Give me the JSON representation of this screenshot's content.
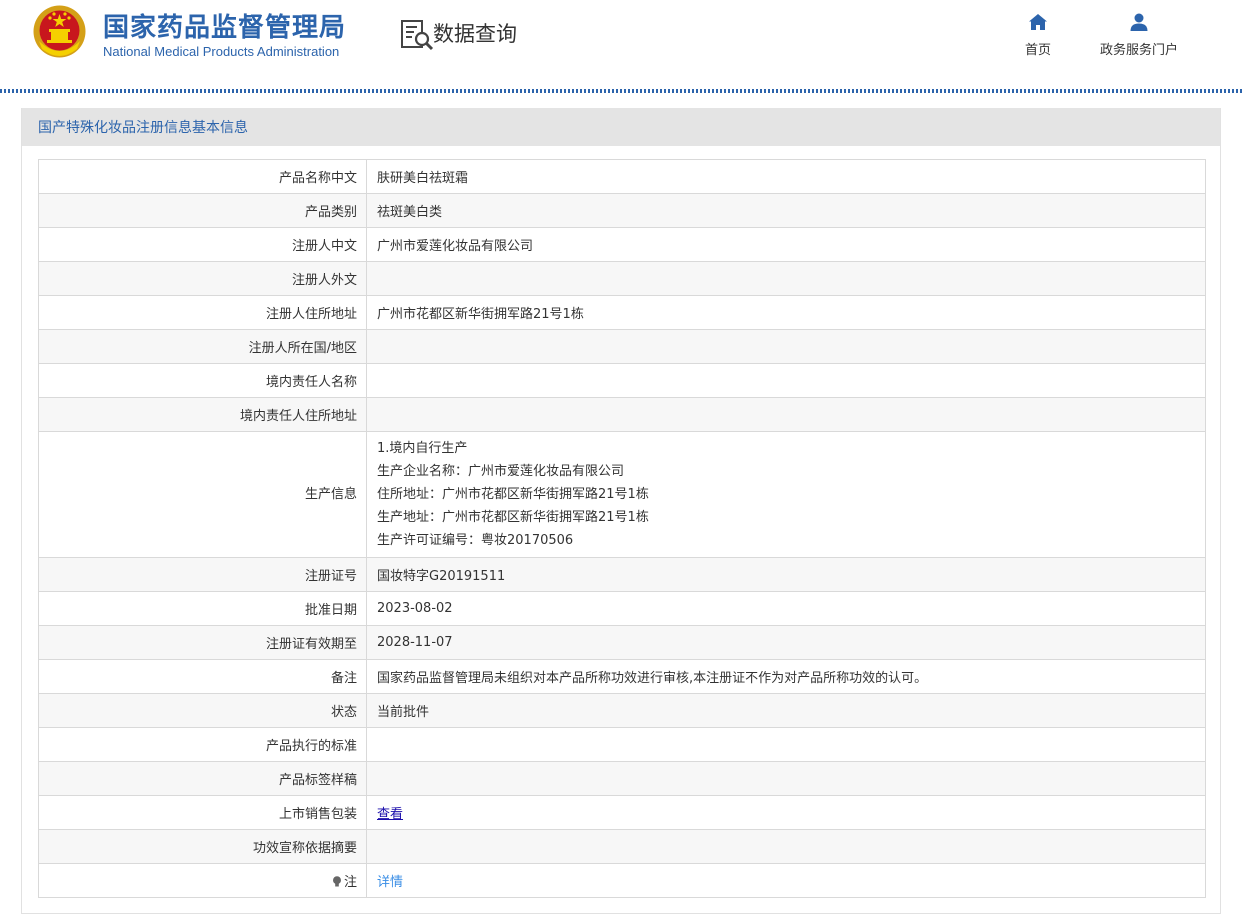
{
  "header": {
    "org_name_cn": "国家药品监督管理局",
    "org_name_en": "National Medical Products Administration",
    "section_title": "数据查询",
    "nav": [
      {
        "label": "首页",
        "icon": "home-icon"
      },
      {
        "label": "政务服务门户",
        "icon": "user-icon"
      }
    ]
  },
  "colors": {
    "brand": "#2c64ac",
    "link": "#3a8ee6",
    "visited_link": "#1a0dab"
  },
  "panel": {
    "title": "国产特殊化妆品注册信息基本信息",
    "rows": [
      {
        "label": "产品名称中文",
        "value": "肤研美白祛斑霜"
      },
      {
        "label": "产品类别",
        "value": "祛斑美白类"
      },
      {
        "label": "注册人中文",
        "value": "广州市爱莲化妆品有限公司"
      },
      {
        "label": "注册人外文",
        "value": ""
      },
      {
        "label": "注册人住所地址",
        "value": "广州市花都区新华街拥军路21号1栋"
      },
      {
        "label": "注册人所在国/地区",
        "value": ""
      },
      {
        "label": "境内责任人名称",
        "value": ""
      },
      {
        "label": "境内责任人住所地址",
        "value": ""
      }
    ],
    "production": {
      "label": "生产信息",
      "lines": [
        "1.境内自行生产",
        "生产企业名称：广州市爱莲化妆品有限公司",
        "住所地址：广州市花都区新华街拥军路21号1栋",
        "生产地址：广州市花都区新华街拥军路21号1栋",
        "生产许可证编号：粤妆20170506"
      ]
    },
    "rows2": [
      {
        "label": "注册证号",
        "value": "国妆特字G20191511"
      },
      {
        "label": "批准日期",
        "value": "2023-08-02"
      },
      {
        "label": "注册证有效期至",
        "value": "2028-11-07"
      },
      {
        "label": "备注",
        "value": "国家药品监督管理局未组织对本产品所称功效进行审核,本注册证不作为对产品所称功效的认可。"
      },
      {
        "label": "状态",
        "value": "当前批件"
      },
      {
        "label": "产品执行的标准",
        "value": ""
      },
      {
        "label": "产品标签样稿",
        "value": ""
      }
    ],
    "sales_package": {
      "label": "上市销售包装",
      "link": "查看"
    },
    "efficacy": {
      "label": "功效宣称依据摘要",
      "value": ""
    },
    "note": {
      "label": "注",
      "link": "详情",
      "icon": "bulb-icon"
    }
  }
}
